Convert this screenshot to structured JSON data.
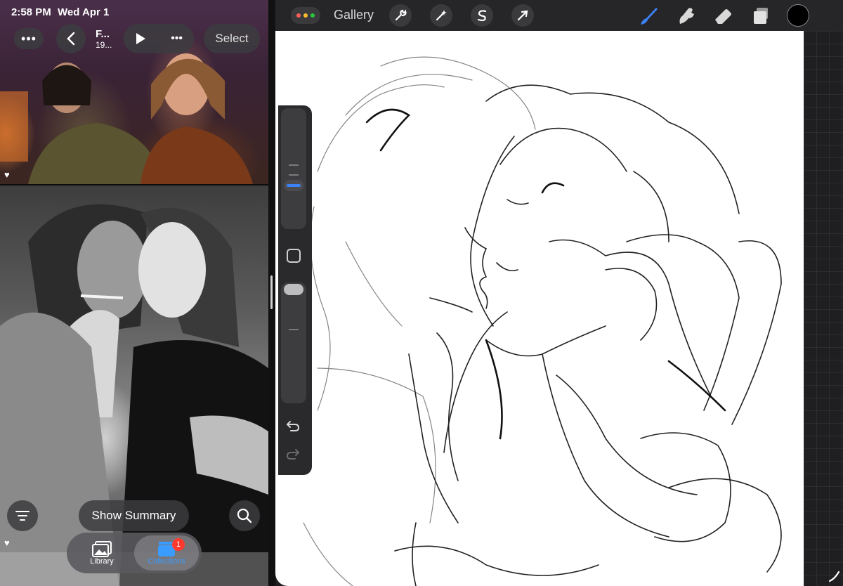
{
  "status_bar": {
    "time": "2:58 PM",
    "date": "Wed Apr 1"
  },
  "photos": {
    "more_icon": "ellipsis-icon",
    "back_icon": "chevron-left-icon",
    "title": "F...",
    "subtitle": "19...",
    "play_icon": "play-icon",
    "select_label": "Select",
    "show_summary_label": "Show Summary",
    "filter_icon": "filter-icon",
    "search_icon": "search-icon",
    "tabs": [
      {
        "label": "Library",
        "icon": "photos-library-icon"
      },
      {
        "label": "Collections",
        "icon": "collections-icon",
        "badge": "1"
      }
    ]
  },
  "procreate": {
    "gallery_label": "Gallery",
    "tools_left": [
      "wrench-icon",
      "magic-wand-icon",
      "selection-s-icon",
      "transform-arrow-icon"
    ],
    "tools_right": [
      "brush-icon",
      "smudge-icon",
      "eraser-icon",
      "layers-icon"
    ],
    "active_tool": "brush-icon",
    "accent": "#3b82f6",
    "current_color": "#000000",
    "window_dot_colors": [
      "#ff5f57",
      "#febc2e",
      "#28c840"
    ]
  }
}
